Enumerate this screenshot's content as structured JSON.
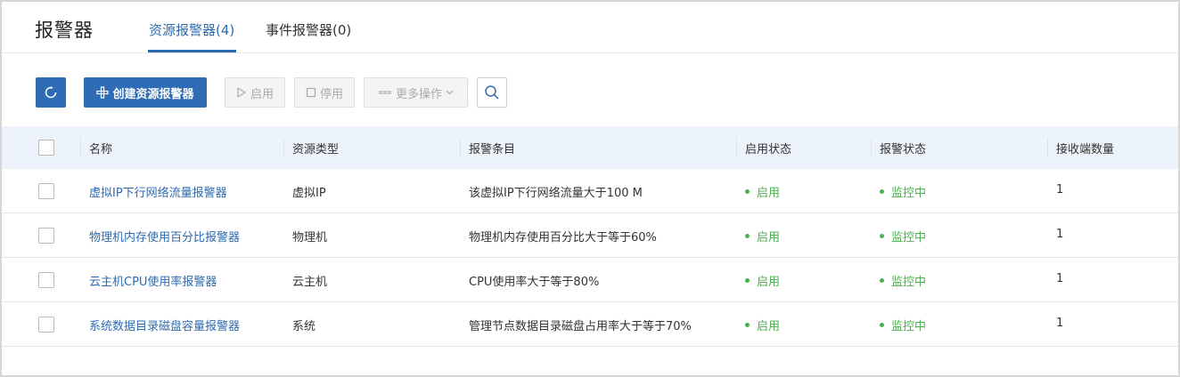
{
  "header": {
    "title": "报警器",
    "tabs": [
      {
        "label": "资源报警器(4)",
        "active": true
      },
      {
        "label": "事件报警器(0)",
        "active": false
      }
    ]
  },
  "toolbar": {
    "refresh_icon": "refresh-icon",
    "create_label": "创建资源报警器",
    "enable_label": "启用",
    "stop_label": "停用",
    "more_label": "更多操作",
    "search_icon": "search-icon"
  },
  "table": {
    "columns": [
      "名称",
      "资源类型",
      "报警条目",
      "启用状态",
      "报警状态",
      "接收端数量"
    ],
    "rows": [
      {
        "name": "虚拟IP下行网络流量报警器",
        "type": "虚拟IP",
        "rule": "该虚拟IP下行网络流量大于100 M",
        "enabled": "启用",
        "alarm": "监控中",
        "receivers": "1"
      },
      {
        "name": "物理机内存使用百分比报警器",
        "type": "物理机",
        "rule": "物理机内存使用百分比大于等于60%",
        "enabled": "启用",
        "alarm": "监控中",
        "receivers": "1"
      },
      {
        "name": "云主机CPU使用率报警器",
        "type": "云主机",
        "rule": "CPU使用率大于等于80%",
        "enabled": "启用",
        "alarm": "监控中",
        "receivers": "1"
      },
      {
        "name": "系统数据目录磁盘容量报警器",
        "type": "系统",
        "rule": "管理节点数据目录磁盘占用率大于等于70%",
        "enabled": "启用",
        "alarm": "监控中",
        "receivers": "1"
      }
    ]
  },
  "colors": {
    "accent": "#2e6cb5",
    "link": "#2d6bb0",
    "status_ok": "#4caf50",
    "header_bg": "#edf3fa"
  }
}
